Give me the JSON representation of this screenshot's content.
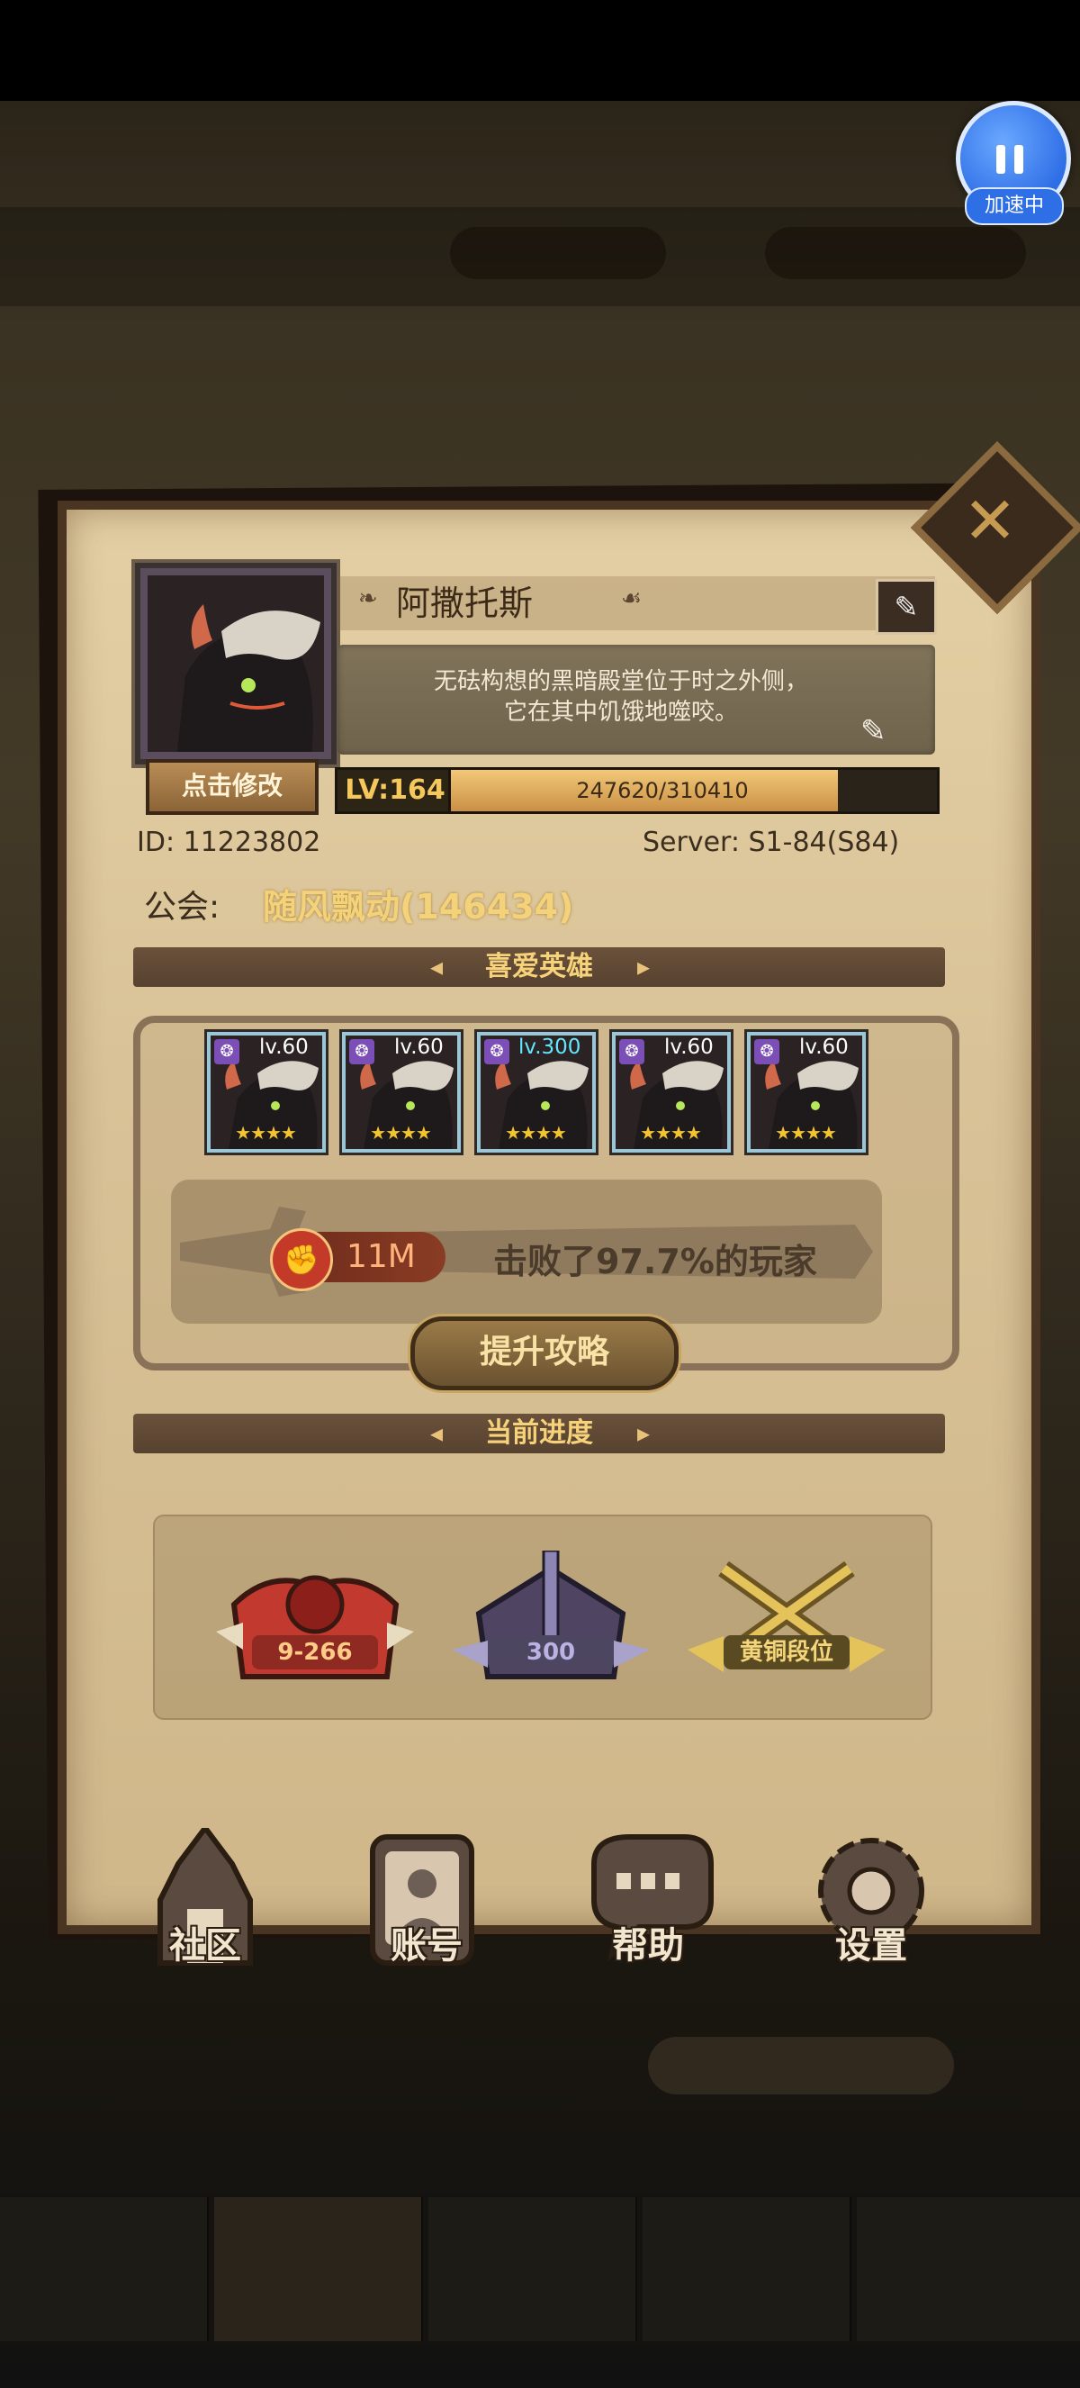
{
  "speed_indicator": {
    "label": "加速中"
  },
  "profile": {
    "name": "阿撒托斯",
    "motto_line1": "无砝构想的黑暗殿堂位于时之外侧，",
    "motto_line2": "它在其中饥饿地噬咬。",
    "edit_avatar_label": "点击修改",
    "level": "LV:164",
    "xp_text": "247620/310410",
    "xp_fraction": 0.797,
    "id_label": "ID:",
    "id_value": "11223802",
    "server_text": "Server: S1-84(S84)",
    "guild_label": "公会:",
    "guild_name": "随风飘动(146434)"
  },
  "favorite_heroes": {
    "title": "喜爱英雄",
    "heroes": [
      {
        "level": "lv.60",
        "stars": "★★★★"
      },
      {
        "level": "lv.60",
        "stars": "★★★★"
      },
      {
        "level": "lv.300",
        "stars": "★★★★"
      },
      {
        "level": "lv.60",
        "stars": "★★★★"
      },
      {
        "level": "lv.60",
        "stars": "★★★★"
      }
    ],
    "power": "11M",
    "defeat_text": "击败了97.7%的玩家",
    "strategy_button": "提升攻略"
  },
  "progress": {
    "title": "当前进度",
    "items": [
      {
        "label": "9-266",
        "icon": "campaign-book-icon"
      },
      {
        "label": "300",
        "icon": "tower-sword-icon"
      },
      {
        "label": "黄铜段位",
        "icon": "arena-crossed-swords-icon"
      }
    ]
  },
  "menu": {
    "community": "社区",
    "account": "账号",
    "help": "帮助",
    "settings": "设置"
  },
  "colors": {
    "accent_gold": "#f6d27a",
    "panel_bg": "#dcc69b",
    "frame_dark": "#4a3422",
    "speed_blue": "#2f6fe6"
  }
}
